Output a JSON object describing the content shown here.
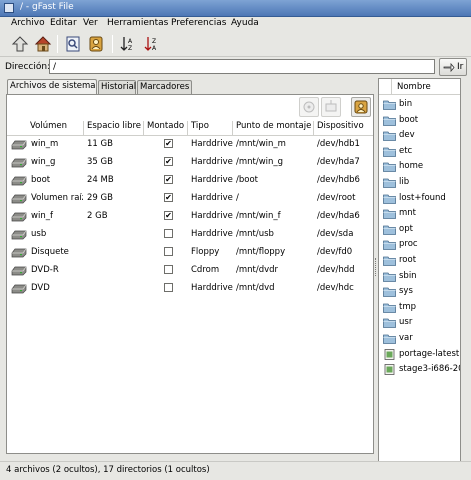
{
  "window": {
    "title": "/ - gFast File"
  },
  "menubar": [
    "Archivo",
    "Editar",
    "Ver",
    "Herramientas",
    "Preferencias",
    "Ayuda"
  ],
  "toolbar": {
    "buttons": [
      "up-arrow-icon",
      "home-icon",
      "properties-icon",
      "bookmark-icon",
      "sort-ascending-icon",
      "sort-descending-icon"
    ]
  },
  "address": {
    "label": "Dirección:",
    "value": "/",
    "go_label": "Ir"
  },
  "tabs": [
    "Archivos de sistema",
    "Historial",
    "Marcadores"
  ],
  "filesystems": {
    "columns": [
      "Volúmen",
      "Espacio libre",
      "Montado",
      "Tipo",
      "Punto de montaje",
      "Dispositivo"
    ],
    "rows": [
      {
        "volume": "win_m",
        "free": "11 GB",
        "mounted": true,
        "type": "Harddrive",
        "mountpoint": "/mnt/win_m",
        "device": "/dev/hdb1"
      },
      {
        "volume": "win_g",
        "free": "35 GB",
        "mounted": true,
        "type": "Harddrive",
        "mountpoint": "/mnt/win_g",
        "device": "/dev/hda7"
      },
      {
        "volume": "boot",
        "free": "24 MB",
        "mounted": true,
        "type": "Harddrive",
        "mountpoint": "/boot",
        "device": "/dev/hdb6"
      },
      {
        "volume": "Volumen raíz",
        "free": "29 GB",
        "mounted": true,
        "type": "Harddrive",
        "mountpoint": "/",
        "device": "/dev/root"
      },
      {
        "volume": "win_f",
        "free": "2 GB",
        "mounted": true,
        "type": "Harddrive",
        "mountpoint": "/mnt/win_f",
        "device": "/dev/hda6"
      },
      {
        "volume": "usb",
        "free": "",
        "mounted": false,
        "type": "Harddrive",
        "mountpoint": "/mnt/usb",
        "device": "/dev/sda"
      },
      {
        "volume": "Disquete",
        "free": "",
        "mounted": false,
        "type": "Floppy",
        "mountpoint": "/mnt/floppy",
        "device": "/dev/fd0"
      },
      {
        "volume": "DVD-R",
        "free": "",
        "mounted": false,
        "type": "Cdrom",
        "mountpoint": "/mnt/dvdr",
        "device": "/dev/hdd"
      },
      {
        "volume": "DVD",
        "free": "",
        "mounted": false,
        "type": "Harddrive",
        "mountpoint": "/mnt/dvd",
        "device": "/dev/hdc"
      }
    ]
  },
  "file_list": {
    "column": "Nombre",
    "items": [
      {
        "name": "bin",
        "kind": "folder"
      },
      {
        "name": "boot",
        "kind": "folder"
      },
      {
        "name": "dev",
        "kind": "folder"
      },
      {
        "name": "etc",
        "kind": "folder"
      },
      {
        "name": "home",
        "kind": "folder"
      },
      {
        "name": "lib",
        "kind": "folder"
      },
      {
        "name": "lost+found",
        "kind": "folder"
      },
      {
        "name": "mnt",
        "kind": "folder"
      },
      {
        "name": "opt",
        "kind": "folder"
      },
      {
        "name": "proc",
        "kind": "folder"
      },
      {
        "name": "root",
        "kind": "folder"
      },
      {
        "name": "sbin",
        "kind": "folder"
      },
      {
        "name": "sys",
        "kind": "folder"
      },
      {
        "name": "tmp",
        "kind": "folder"
      },
      {
        "name": "usr",
        "kind": "folder"
      },
      {
        "name": "var",
        "kind": "folder"
      },
      {
        "name": "portage-latest.t",
        "kind": "file"
      },
      {
        "name": "stage3-i686-20",
        "kind": "file"
      }
    ]
  },
  "status": "4 archivos (2 ocultos), 17 directorios (1 ocultos)"
}
